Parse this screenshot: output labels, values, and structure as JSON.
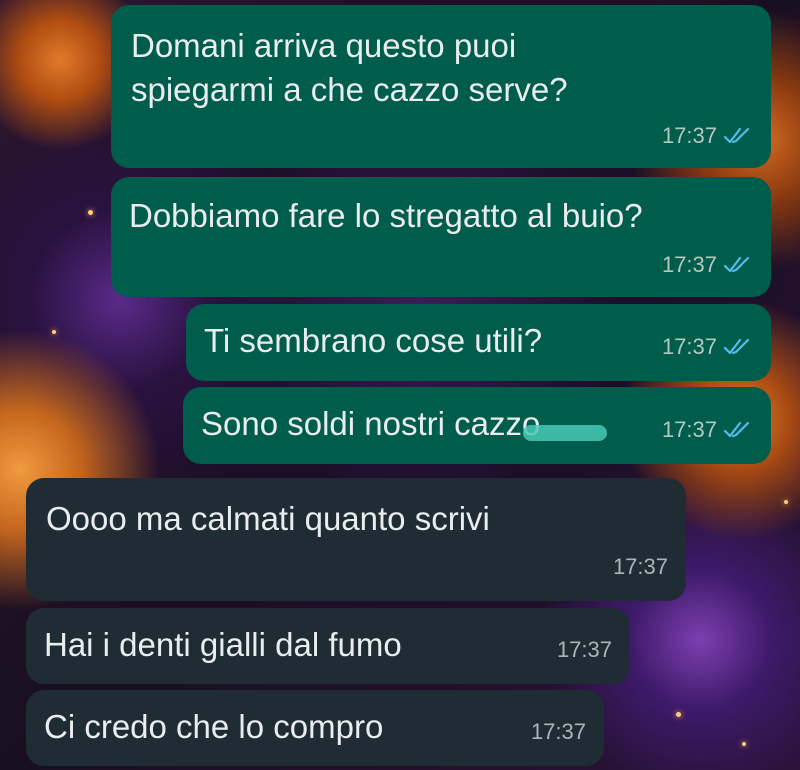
{
  "messages": [
    {
      "direction": "outgoing",
      "lines": [
        "Domani arriva questo puoi",
        "spiegarmi a che cazzo serve?"
      ],
      "time": "17:37",
      "status": "read"
    },
    {
      "direction": "outgoing",
      "lines": [
        "Dobbiamo fare lo stregatto al buio?"
      ],
      "time": "17:37",
      "status": "read"
    },
    {
      "direction": "outgoing",
      "lines": [
        "Ti sembrano cose utili?"
      ],
      "time": "17:37",
      "status": "read"
    },
    {
      "direction": "outgoing",
      "lines": [
        "Sono soldi nostri cazzo"
      ],
      "time": "17:37",
      "status": "read",
      "redacted": true
    },
    {
      "direction": "incoming",
      "lines": [
        "Oooo ma calmati quanto scrivi"
      ],
      "time": "17:37"
    },
    {
      "direction": "incoming",
      "lines": [
        "Hai i denti gialli dal fumo"
      ],
      "time": "17:37"
    },
    {
      "direction": "incoming",
      "lines": [
        "Ci credo che lo compro"
      ],
      "time": "17:37"
    }
  ],
  "colors": {
    "outgoing_bubble": "#005c4b",
    "incoming_bubble": "#202c33",
    "read_tick": "#53bdeb",
    "text": "#e9edef"
  },
  "icons": {
    "read_receipt": "double-check-icon"
  }
}
